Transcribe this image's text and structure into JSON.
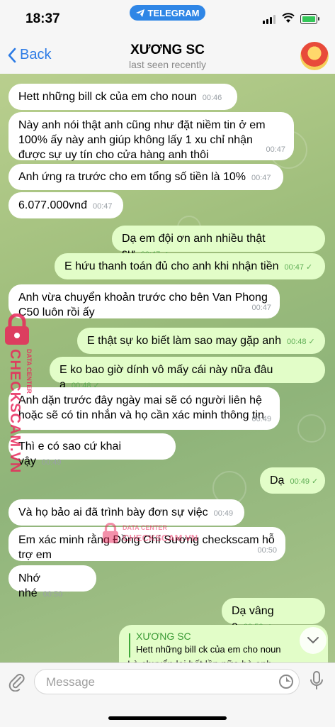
{
  "status": {
    "time": "18:37",
    "app_pill": "TELEGRAM"
  },
  "nav": {
    "back_label": "Back",
    "title": "XƯƠNG SC",
    "subtitle": "last seen recently"
  },
  "messages": [
    {
      "text": "Hett những bill ck của em cho noun",
      "time": "00:46",
      "dir": "in"
    },
    {
      "text": "Này anh nói thật anh cũng như đặt niềm tin ở em 100% ấy này anh giúp không lấy 1 xu chỉ nhận được sự uy tín cho cửa hàng anh thôi",
      "time": "00:47",
      "dir": "in"
    },
    {
      "text": "Anh ứng ra trước cho em tổng số tiền là 10%",
      "time": "00:47",
      "dir": "in"
    },
    {
      "text": "6.077.000vnđ",
      "time": "00:47",
      "dir": "in"
    },
    {
      "text": "Dạ em đội ơn anh nhiều thật sự",
      "time": "00:47",
      "dir": "out"
    },
    {
      "text": "E hứu thanh toán đủ cho anh khi nhận tiền",
      "time": "00:47",
      "dir": "out"
    },
    {
      "text": "Anh vừa chuyển khoản trước cho bên Van Phong C50 luôn rồi ấy",
      "time": "00:47",
      "dir": "in"
    },
    {
      "text": "E thật sự ko biết làm sao may gặp anh",
      "time": "00:48",
      "dir": "out"
    },
    {
      "text": "E ko bao giờ dính vô mấy cái này nữa đâu ạ",
      "time": "00:48",
      "dir": "out"
    },
    {
      "text": "Anh dặn trước đây ngày mai sẽ có người liên hệ hoặc sẽ có tin nhắn và họ cần xác minh thông tin",
      "time": "00:49",
      "dir": "in"
    },
    {
      "text": "Thì e có sao cứ khai vậy",
      "time": "00:49",
      "dir": "in"
    },
    {
      "text": "Dạ",
      "time": "00:49",
      "dir": "out"
    },
    {
      "text": "Và họ bảo ai đã trình bày đơn sự việc",
      "time": "00:49",
      "dir": "in"
    },
    {
      "text": "Em xác minh rằng Đồng Chí Sương checkscam hỗ trợ em",
      "time": "00:50",
      "dir": "in"
    },
    {
      "text": "Nhớ nhé",
      "time": "00:50",
      "dir": "in"
    },
    {
      "text": "Dạ vâng ạ",
      "time": "00:50",
      "dir": "out"
    }
  ],
  "reply": {
    "name": "XƯƠNG SC",
    "quoted": "Hett những bill ck của em cho noun",
    "partial": "Là chuyển lại bất lần nữa bà anh"
  },
  "watermark": {
    "side": "CHECKSCAM.VN",
    "side_small": "DATA CENTER",
    "center_top": "DATA CENTER",
    "center_bottom": "CHECKSCAM.VN"
  },
  "input": {
    "placeholder": "Message"
  },
  "colors": {
    "accent": "#2c7be5",
    "outgoing": "#e2fdc8",
    "incoming": "#ffffff",
    "tick": "#5fae55"
  },
  "icons": [
    "telegram-icon",
    "back-chevron-icon",
    "paperclip-icon",
    "sticker-icon",
    "microphone-icon",
    "chevron-down-icon"
  ]
}
